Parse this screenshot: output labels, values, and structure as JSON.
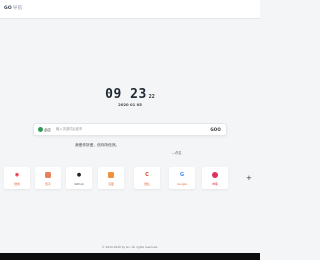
{
  "header": {
    "logo_main": "GO",
    "logo_sub": "导航"
  },
  "clock": {
    "time": "09 23",
    "seconds": "22",
    "date": "2020 01 05"
  },
  "search": {
    "engine_label": "必应",
    "placeholder": "输入关键词后回车",
    "button_label": "GOO"
  },
  "quote": {
    "text": "我爱你所爱，信你所信然。",
    "author": "—佚名"
  },
  "shortcuts": [
    {
      "label": "微博",
      "icon": "weibo-icon",
      "color": "#e6162d",
      "text_color": "#e06a3c"
    },
    {
      "label": "知乎",
      "icon": "zhihu-icon",
      "color": "#e8805a",
      "text_color": "#e06a3c"
    },
    {
      "label": "Github",
      "icon": "github-icon",
      "color": "#222222",
      "text_color": "#555555"
    },
    {
      "label": "豆瓣",
      "icon": "douban-icon",
      "color": "#f0903c",
      "text_color": "#e06a3c"
    },
    {
      "label": "微信",
      "icon": "wechat-icon",
      "color": "#d04a2a",
      "text_color": "#e06a3c"
    },
    {
      "label": "Google",
      "icon": "google-icon",
      "color": "#4285f4",
      "text_color": "#e06a3c"
    },
    {
      "label": "哔哩",
      "icon": "bilibili-icon",
      "color": "#e0315a",
      "text_color": "#e0315a"
    }
  ],
  "add_label": "+",
  "footer": {
    "text": "© 2019-2020 by Go. All rights reserved."
  }
}
